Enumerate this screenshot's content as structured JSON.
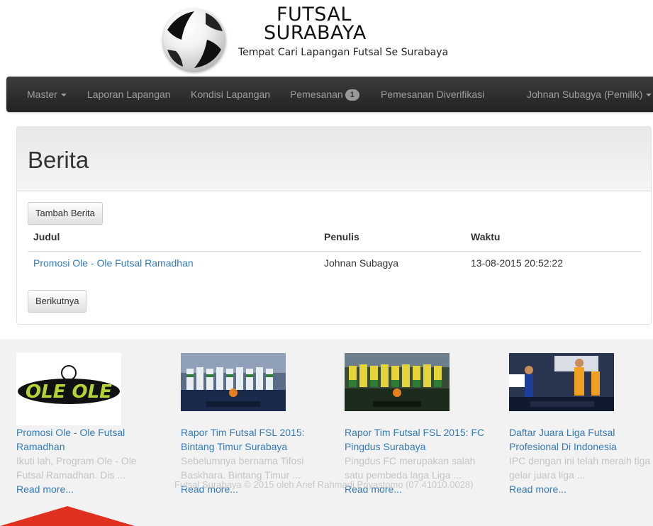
{
  "brand": {
    "title_line1": "FUTSAL",
    "title_line2": "SURABAYA",
    "tagline": "Tempat Cari Lapangan Futsal Se Surabaya"
  },
  "nav": {
    "master": "Master",
    "laporan": "Laporan Lapangan",
    "kondisi": "Kondisi Lapangan",
    "pemesanan": "Pemesanan",
    "pemesanan_badge": "1",
    "diverifikasi": "Pemesanan Diverifikasi",
    "user": "Johnan Subagya (Pemilik)"
  },
  "page": {
    "title": "Berita",
    "add_button": "Tambah Berita",
    "next_button": "Berikutnya"
  },
  "table": {
    "headers": [
      "Judul",
      "Penulis",
      "Waktu"
    ],
    "rows": [
      [
        "Promosi Ole - Ole Futsal Ramadhan",
        "Johnan Subagya",
        "13-08-2015 20:52:22"
      ]
    ]
  },
  "news": [
    {
      "title": "Promosi Ole - Ole Futsal Ramadhan",
      "excerpt": "Ikuti lah, Program Ole - Ole Futsal Ramadhan. Dis ...",
      "read_more": "Read more...",
      "thumb_text": "OLE OLE"
    },
    {
      "title": "Rapor Tim Futsal FSL 2015: Bintang Timur Surabaya",
      "excerpt": "Sebelumnya bernama Tifosi Baskhara. Bintang Timur ...",
      "read_more": "Read more..."
    },
    {
      "title": "Rapor Tim Futsal FSL 2015: FC Pingdus Surabaya",
      "excerpt": "Pingdus FC merupakan salah satu pembeda laga Liga ...",
      "read_more": "Read more..."
    },
    {
      "title": "Daftar Juara Liga Futsal Profesional Di Indonesia",
      "excerpt": "IPC dengan ini telah meraih tiga gelar juara liga ...",
      "read_more": "Read more..."
    }
  ],
  "footer": {
    "copyright": "Futsal Surabaya © 2015 oleh Arief Rahmadi Priyastomo (07.41010.0028)"
  },
  "colors": {
    "navbar": "#222222",
    "link": "#337ab7",
    "footer_bg": "#f2f2f2"
  }
}
